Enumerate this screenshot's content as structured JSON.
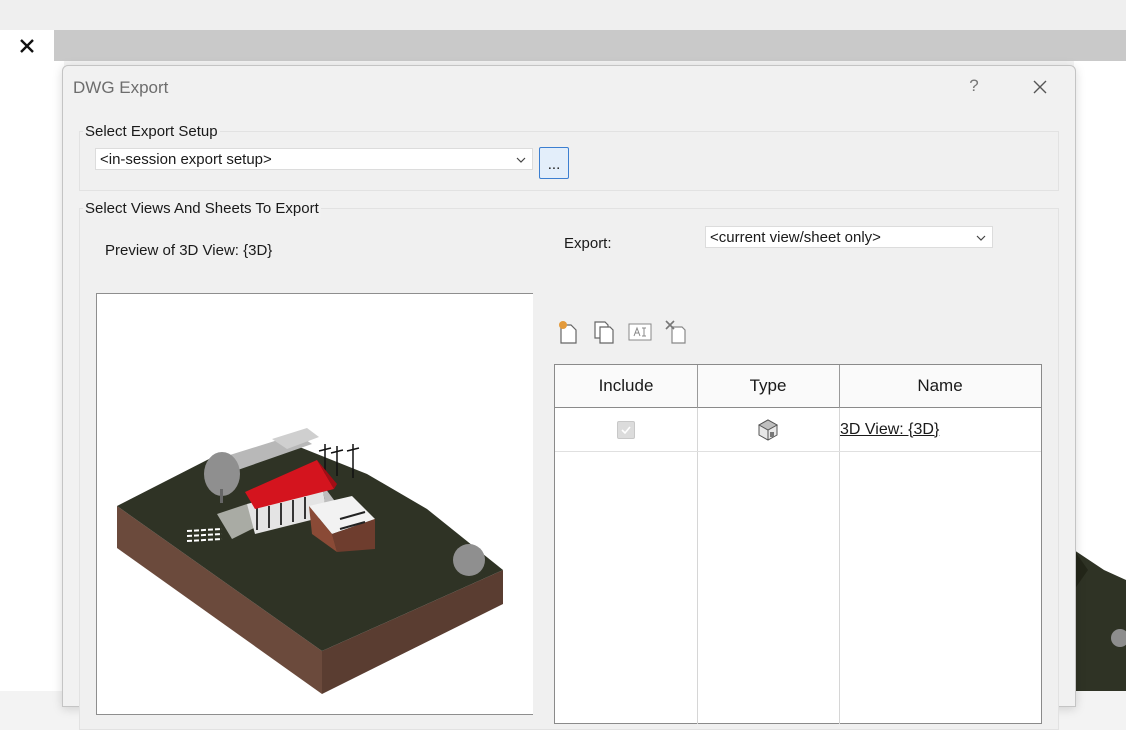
{
  "dialog": {
    "title": "DWG Export",
    "help_label": "?"
  },
  "export_setup": {
    "group_label": "Select Export Setup",
    "selected": "<in-session export setup>",
    "more_button_label": "..."
  },
  "views": {
    "group_label": "Select Views And Sheets To Export",
    "preview_label": "Preview of 3D View: {3D}",
    "export_label": "Export:",
    "export_selected": "<current view/sheet only>"
  },
  "toolbar": {
    "icons": [
      "new-set-icon",
      "duplicate-set-icon",
      "rename-set-icon",
      "delete-set-icon"
    ]
  },
  "table": {
    "columns": [
      "Include",
      "Type",
      "Name"
    ],
    "rows": [
      {
        "include": true,
        "type_icon": "3d-view-icon",
        "name": "3D View: {3D}"
      }
    ]
  },
  "colors": {
    "accent": "#3c7fd1",
    "roof": "#d4141e",
    "terrain": "#2f3325",
    "soil": "#6b4a3c"
  }
}
